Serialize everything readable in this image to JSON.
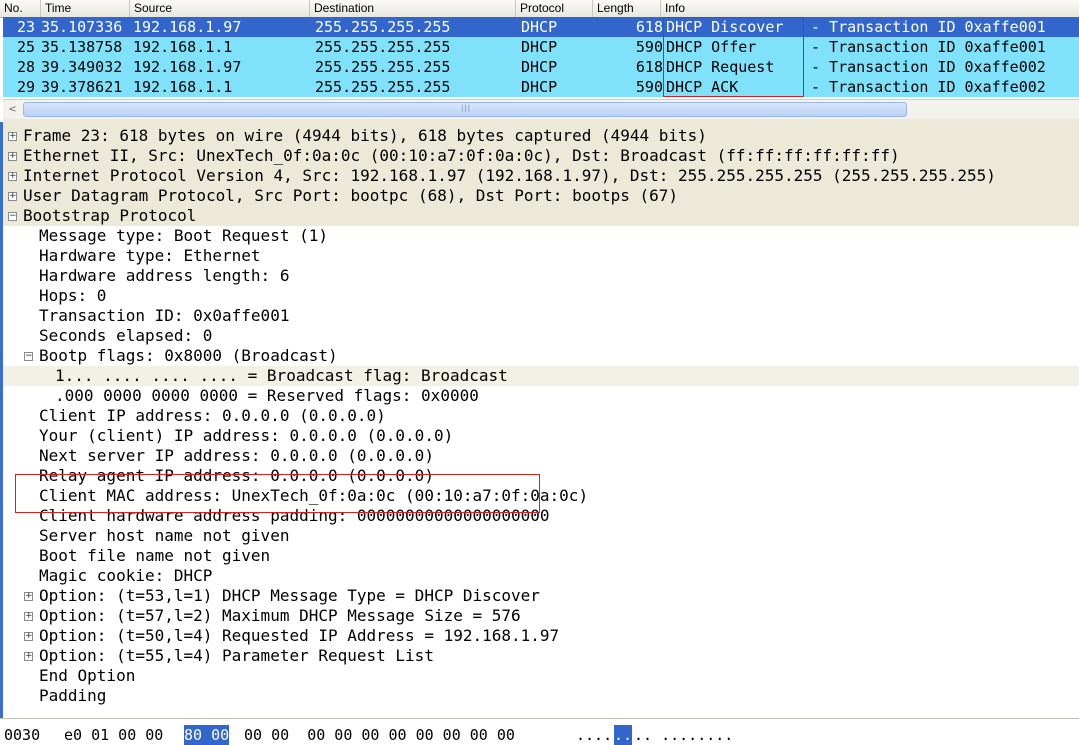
{
  "packet_list": {
    "columns": [
      "No.",
      "Time",
      "Source",
      "Destination",
      "Protocol",
      "Length",
      "Info"
    ],
    "rows": [
      {
        "no": "23",
        "time": "35.107336",
        "source": "192.168.1.97",
        "destination": "255.255.255.255",
        "protocol": "DHCP",
        "length": "618",
        "info": "DHCP Discover",
        "info_rest": "- Transaction ID 0xaffe001",
        "selected": true
      },
      {
        "no": "25",
        "time": "35.138758",
        "source": "192.168.1.1",
        "destination": "255.255.255.255",
        "protocol": "DHCP",
        "length": "590",
        "info": "DHCP Offer",
        "info_rest": "- Transaction ID 0xaffe001",
        "selected": false
      },
      {
        "no": "28",
        "time": "39.349032",
        "source": "192.168.1.97",
        "destination": "255.255.255.255",
        "protocol": "DHCP",
        "length": "618",
        "info": "DHCP Request",
        "info_rest": "- Transaction ID 0xaffe002",
        "selected": false
      },
      {
        "no": "29",
        "time": "39.378621",
        "source": "192.168.1.1",
        "destination": "255.255.255.255",
        "protocol": "DHCP",
        "length": "590",
        "info": "DHCP ACK",
        "info_rest": "- Transaction ID 0xaffe002",
        "selected": false
      }
    ]
  },
  "details": {
    "lines": [
      {
        "text": "Frame 23: 618 bytes on wire (4944 bits), 618 bytes captured (4944 bits)",
        "level": 0,
        "expander": "+",
        "hl": "hl"
      },
      {
        "text": "Ethernet II, Src: UnexTech_0f:0a:0c (00:10:a7:0f:0a:0c), Dst: Broadcast (ff:ff:ff:ff:ff:ff)",
        "level": 0,
        "expander": "+",
        "hl": "hl"
      },
      {
        "text": "Internet Protocol Version 4, Src: 192.168.1.97 (192.168.1.97), Dst: 255.255.255.255 (255.255.255.255)",
        "level": 0,
        "expander": "+",
        "hl": "hl"
      },
      {
        "text": "User Datagram Protocol, Src Port: bootpc (68), Dst Port: bootps (67)",
        "level": 0,
        "expander": "+",
        "hl": "hl"
      },
      {
        "text": "Bootstrap Protocol",
        "level": 0,
        "expander": "-",
        "hl": "hl"
      },
      {
        "text": "Message type: Boot Request (1)",
        "level": 1,
        "expander": "",
        "hl": ""
      },
      {
        "text": "Hardware type: Ethernet",
        "level": 1,
        "expander": "",
        "hl": ""
      },
      {
        "text": "Hardware address length: 6",
        "level": 1,
        "expander": "",
        "hl": ""
      },
      {
        "text": "Hops: 0",
        "level": 1,
        "expander": "",
        "hl": ""
      },
      {
        "text": "Transaction ID: 0x0affe001",
        "level": 1,
        "expander": "",
        "hl": ""
      },
      {
        "text": "Seconds elapsed: 0",
        "level": 1,
        "expander": "",
        "hl": ""
      },
      {
        "text": "Bootp flags: 0x8000 (Broadcast)",
        "level": 1,
        "expander": "-",
        "hl": ""
      },
      {
        "text": "1... .... .... .... = Broadcast flag: Broadcast",
        "level": 2,
        "expander": "",
        "hl": "hl2"
      },
      {
        "text": ".000 0000 0000 0000 = Reserved flags: 0x0000",
        "level": 2,
        "expander": "",
        "hl": ""
      },
      {
        "text": "Client IP address: 0.0.0.0 (0.0.0.0)",
        "level": 1,
        "expander": "",
        "hl": ""
      },
      {
        "text": "Your (client) IP address: 0.0.0.0 (0.0.0.0)",
        "level": 1,
        "expander": "",
        "hl": ""
      },
      {
        "text": "Next server IP address: 0.0.0.0 (0.0.0.0)",
        "level": 1,
        "expander": "",
        "hl": ""
      },
      {
        "text": "Relay agent IP address: 0.0.0.0 (0.0.0.0)",
        "level": 1,
        "expander": "",
        "hl": ""
      },
      {
        "text": "Client MAC address: UnexTech_0f:0a:0c (00:10:a7:0f:0a:0c)",
        "level": 1,
        "expander": "",
        "hl": ""
      },
      {
        "text": "Client hardware address padding: 00000000000000000000",
        "level": 1,
        "expander": "",
        "hl": ""
      },
      {
        "text": "Server host name not given",
        "level": 1,
        "expander": "",
        "hl": ""
      },
      {
        "text": "Boot file name not given",
        "level": 1,
        "expander": "",
        "hl": ""
      },
      {
        "text": "Magic cookie: DHCP",
        "level": 1,
        "expander": "",
        "hl": ""
      },
      {
        "text": "Option: (t=53,l=1) DHCP Message Type = DHCP Discover",
        "level": 1,
        "expander": "+",
        "hl": ""
      },
      {
        "text": "Option: (t=57,l=2) Maximum DHCP Message Size = 576",
        "level": 1,
        "expander": "+",
        "hl": ""
      },
      {
        "text": "Option: (t=50,l=4) Requested IP Address = 192.168.1.97",
        "level": 1,
        "expander": "+",
        "hl": ""
      },
      {
        "text": "Option: (t=55,l=4) Parameter Request List",
        "level": 1,
        "expander": "+",
        "hl": ""
      },
      {
        "text": "End Option",
        "level": 1,
        "expander": "",
        "hl": ""
      },
      {
        "text": "Padding",
        "level": 1,
        "expander": "",
        "hl": ""
      }
    ]
  },
  "hex": {
    "offset": "0030",
    "bytes_before": "e0 01 00 00",
    "bytes_selected": "80 00",
    "bytes_after": "00 00  00 00 00 00 00 00 00 00",
    "ascii_before": "....",
    "ascii_selected": "..",
    "ascii_after": ".. ........"
  },
  "colors": {
    "row_bg": "#7fe2fa",
    "selected_bg": "#3266cc",
    "highlight_box": "#d42020",
    "tree_header_bg": "#ece9d8"
  }
}
